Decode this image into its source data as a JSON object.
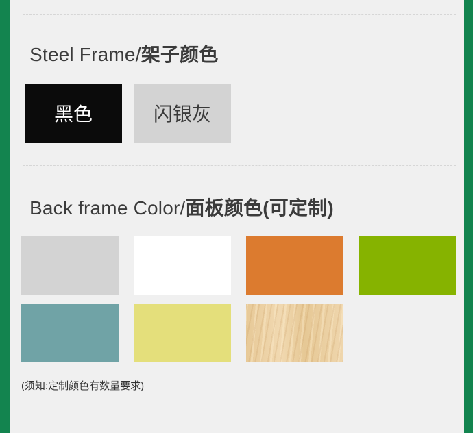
{
  "steel_frame": {
    "title_en": "Steel Frame/",
    "title_cn": "架子颜色",
    "options": [
      {
        "label": "黑色",
        "color": "#0b0b0b"
      },
      {
        "label": "闪银灰",
        "color": "#d3d3d3"
      }
    ]
  },
  "back_frame": {
    "title_en": "Back frame Color/",
    "title_cn": "面板颜色(可定制)",
    "swatches": [
      {
        "color": "#d3d3d3"
      },
      {
        "color": "#ffffff"
      },
      {
        "color": "#dc7b2f"
      },
      {
        "color": "#86b300"
      },
      {
        "color": "#70a3a6"
      },
      {
        "color": "#e4df7b"
      },
      {
        "color": "wood-texture"
      }
    ],
    "note": "(须知:定制颜色有数量要求)"
  }
}
